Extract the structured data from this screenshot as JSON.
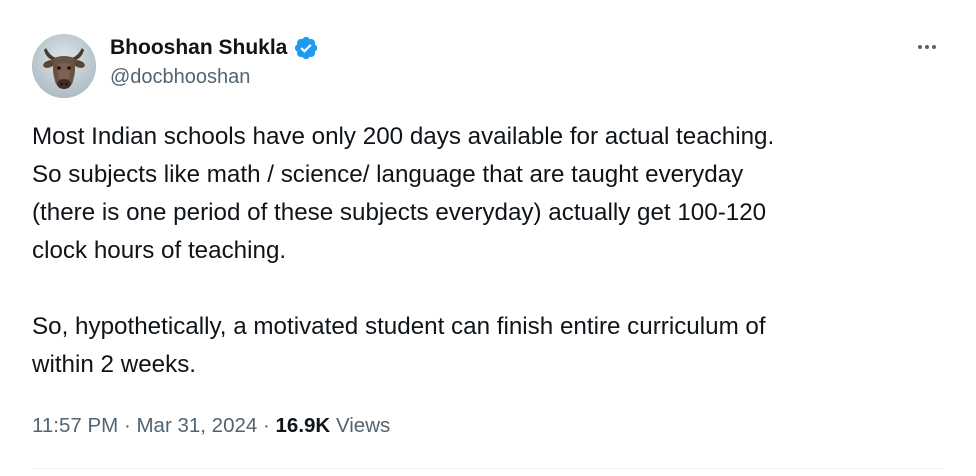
{
  "author": {
    "display_name": "Bhooshan Shukla",
    "handle": "@docbhooshan",
    "verified": true
  },
  "tweet": {
    "paragraphs": [
      [
        "Most Indian schools have only 200 days available for actual teaching.",
        "So subjects like math / science/ language that are taught everyday",
        "(there is one period of these subjects everyday) actually get 100-120",
        "clock hours of teaching."
      ],
      [
        "So, hypothetically, a motivated student can finish entire curriculum of",
        "within 2 weeks."
      ]
    ]
  },
  "meta": {
    "time": "11:57 PM",
    "separator": "·",
    "date": "Mar 31, 2024",
    "views_count": "16.9K",
    "views_label": "Views"
  },
  "icons": {
    "verified": "verified-badge-icon",
    "more": "more-horizontal-icon"
  },
  "colors": {
    "text_primary": "#0f1419",
    "text_secondary": "#536471",
    "verified_blue": "#1d9bf0",
    "divider": "#eff3f4"
  }
}
